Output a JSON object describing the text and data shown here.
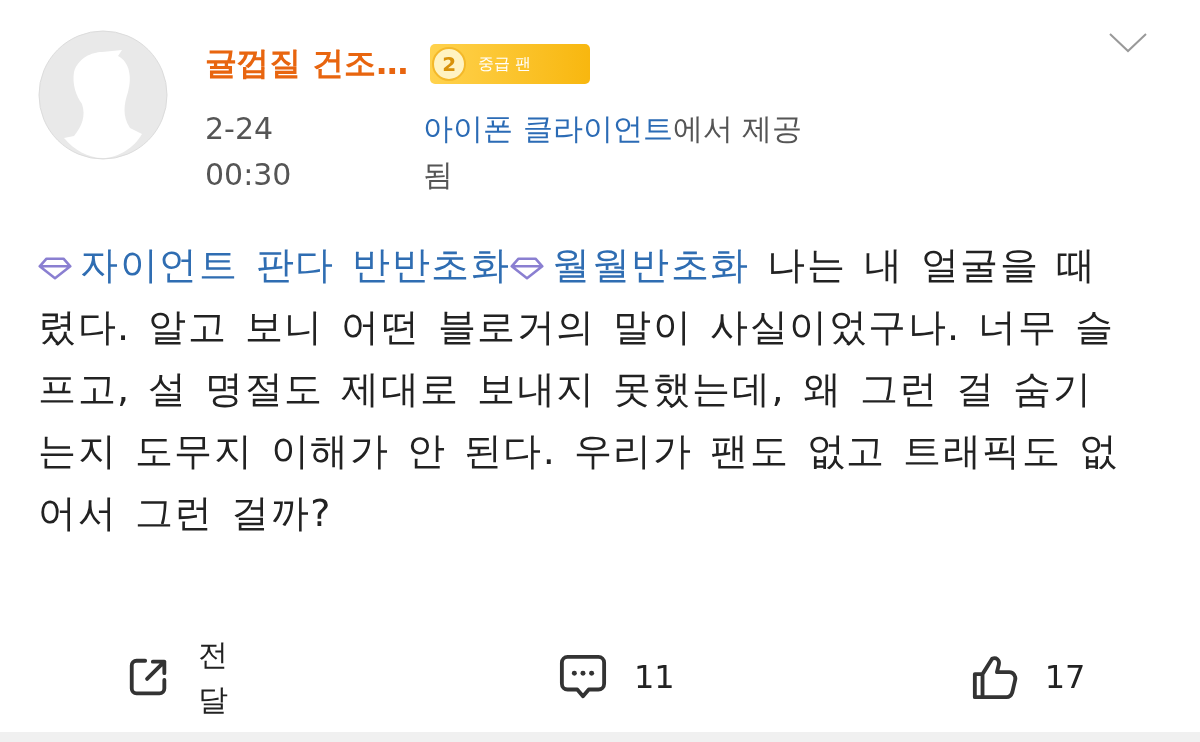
{
  "post": {
    "author": {
      "name": "귤껍질 건조…",
      "badge": {
        "level": "2",
        "label": "중급 팬"
      }
    },
    "time": "2-24 00:30",
    "source": {
      "app": "아이폰 클라이언트",
      "suffix": "에서 제공됨"
    },
    "topics": [
      "자이언트 판다 반반초화",
      "월월반초화"
    ],
    "text": "나는 내 얼굴을 때렸다. 알고 보니 어떤 블로거의 말이 사실이었구나. 너무 슬프고, 설 명절도 제대로 보내지 못했는데, 왜 그런 걸 숨기는지 도무지 이해가 안 된다. 우리가 팬도 없고 트래픽도 없어서 그런 걸까?"
  },
  "actions": [
    {
      "kind": "share",
      "label": "전달"
    },
    {
      "kind": "comment",
      "label": "11"
    },
    {
      "kind": "like",
      "label": "17"
    }
  ]
}
